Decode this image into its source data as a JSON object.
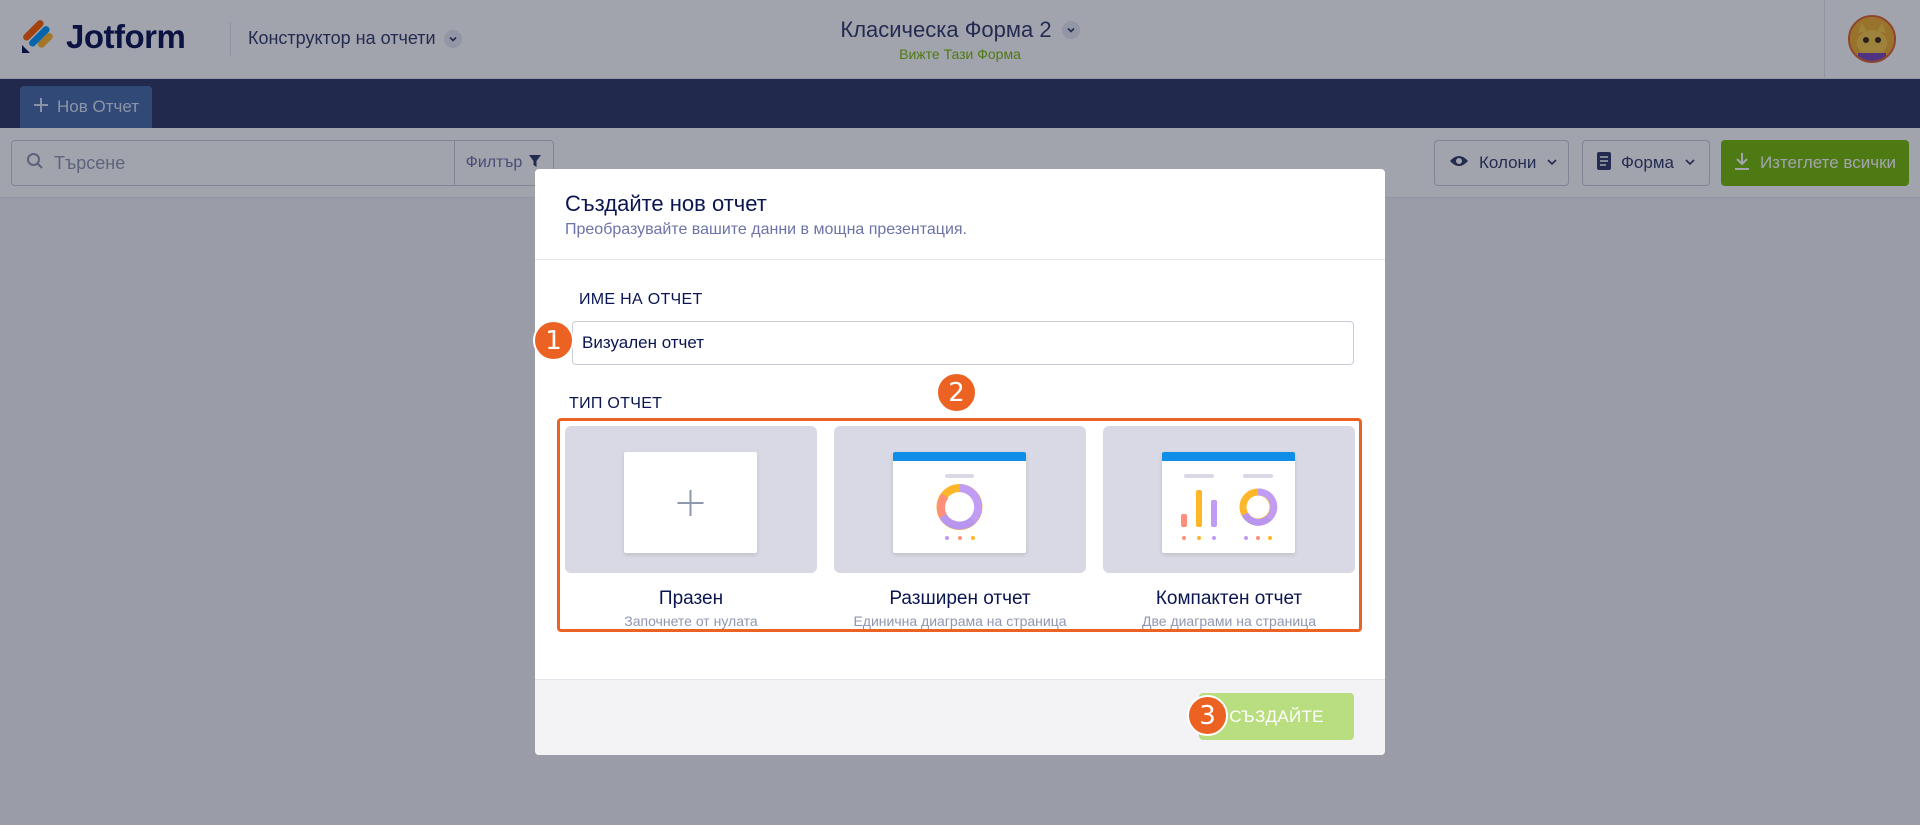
{
  "brand": {
    "name": "Jotform",
    "colors": {
      "orange": "#ec6223",
      "blue": "#0e8ee6",
      "yellow": "#ffb629",
      "navy": "#0a1551"
    }
  },
  "header": {
    "builder_label": "Конструктор на отчети",
    "form_title": "Класическа Форма 2",
    "form_link": "Вижте Тази Форма"
  },
  "navbar": {
    "new_report_label": "Нов Отчет"
  },
  "toolbar": {
    "search_placeholder": "Търсене",
    "filter_label": "Филтър",
    "columns_label": "Колони",
    "form_label": "Форма",
    "download_label": "Изтеглете всички",
    "download_color": "#78bb07"
  },
  "modal": {
    "title": "Създайте нов отчет",
    "subtitle": "Преобразувайте вашите данни в мощна презентация.",
    "name_label": "ИМЕ НА ОТЧЕТ",
    "name_value": "Визуален отчет",
    "type_label": "ТИП ОТЧЕТ",
    "report_types": [
      {
        "title": "Празен",
        "desc": "Започнете от нулата",
        "icon": "plus-icon"
      },
      {
        "title": "Разширен отчет",
        "desc": "Единична диаграма на страница",
        "icon": "donut-chart-icon"
      },
      {
        "title": "Компактен отчет",
        "desc": "Две диаграми на страница",
        "icon": "bar-donut-chart-icon"
      }
    ],
    "create_label": "СЪЗДАЙТЕ",
    "create_color": "#b8de80"
  },
  "steps": [
    "1",
    "2",
    "3"
  ]
}
